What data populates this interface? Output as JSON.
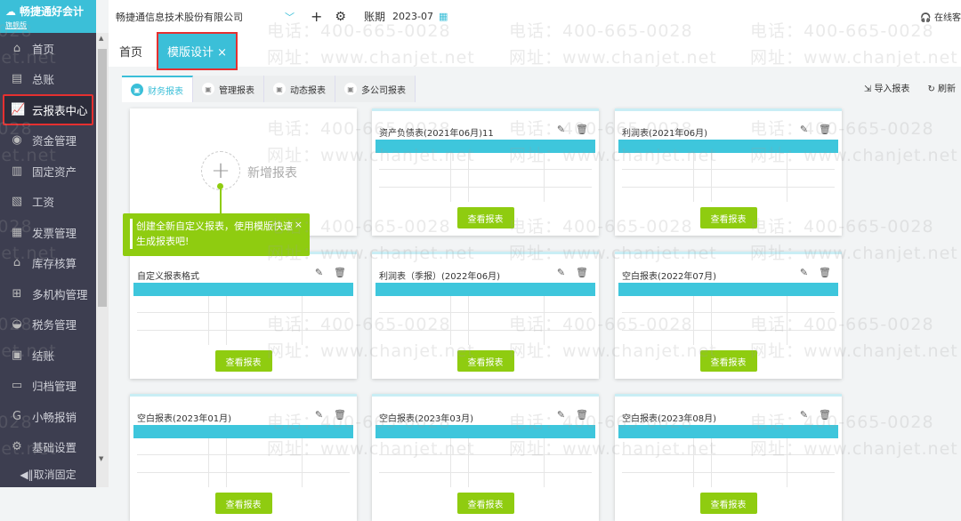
{
  "app": {
    "name": "畅捷通好会计",
    "edition": "旗舰版"
  },
  "sidebar": {
    "items": [
      {
        "label": "首页",
        "icon": "home-icon",
        "glyph": "⌂"
      },
      {
        "label": "总账",
        "icon": "ledger-icon",
        "glyph": "▤"
      },
      {
        "label": "云报表中心",
        "icon": "chart-icon",
        "glyph": "📈"
      },
      {
        "label": "资金管理",
        "icon": "money-bag-icon",
        "glyph": "◉"
      },
      {
        "label": "固定资产",
        "icon": "building-icon",
        "glyph": "▥"
      },
      {
        "label": "工资",
        "icon": "salary-icon",
        "glyph": "▧"
      },
      {
        "label": "发票管理",
        "icon": "invoice-icon",
        "glyph": "▦"
      },
      {
        "label": "库存核算",
        "icon": "warehouse-icon",
        "glyph": "⌂"
      },
      {
        "label": "多机构管理",
        "icon": "org-icon",
        "glyph": "⊞"
      },
      {
        "label": "税务管理",
        "icon": "tax-icon",
        "glyph": "◒"
      },
      {
        "label": "结账",
        "icon": "checkout-icon",
        "glyph": "▣"
      },
      {
        "label": "归档管理",
        "icon": "archive-icon",
        "glyph": "▭"
      },
      {
        "label": "小畅报销",
        "icon": "reimburse-icon",
        "glyph": "G"
      },
      {
        "label": "基础设置",
        "icon": "gear-icon",
        "glyph": "⚙"
      }
    ],
    "active": 2,
    "unpin": "◀‖取消固定"
  },
  "topbar": {
    "company": "畅捷通信息技术股份有限公司",
    "period_label": "账期",
    "period": "2023-07",
    "service": "在线客"
  },
  "tabs": [
    {
      "label": "首页"
    },
    {
      "label": "模版设计 ×"
    }
  ],
  "subtabs": [
    {
      "label": "财务报表"
    },
    {
      "label": "管理报表"
    },
    {
      "label": "动态报表"
    },
    {
      "label": "多公司报表"
    }
  ],
  "actions": {
    "import": "导入报表",
    "refresh": "刷新"
  },
  "new_report": {
    "label": "新增报表"
  },
  "tip": {
    "text": "创建全新自定义报表，使用模版快速生成报表吧!",
    "close": "×"
  },
  "view_label": "查看报表",
  "cards": [
    {
      "title": "资产负债表(2021年06月)11"
    },
    {
      "title": "利润表(2021年06月)"
    },
    {
      "title": "自定义报表格式"
    },
    {
      "title": "利润表（季报）(2022年06月)"
    },
    {
      "title": "空白报表(2022年07月)"
    },
    {
      "title": "空白报表(2023年01月)"
    },
    {
      "title": "空白报表(2023年03月)"
    },
    {
      "title": "空白报表(2023年08月)"
    }
  ],
  "watermark": {
    "phone": "电话：400-665-0028",
    "site": "网址：www.chanjet.net"
  }
}
